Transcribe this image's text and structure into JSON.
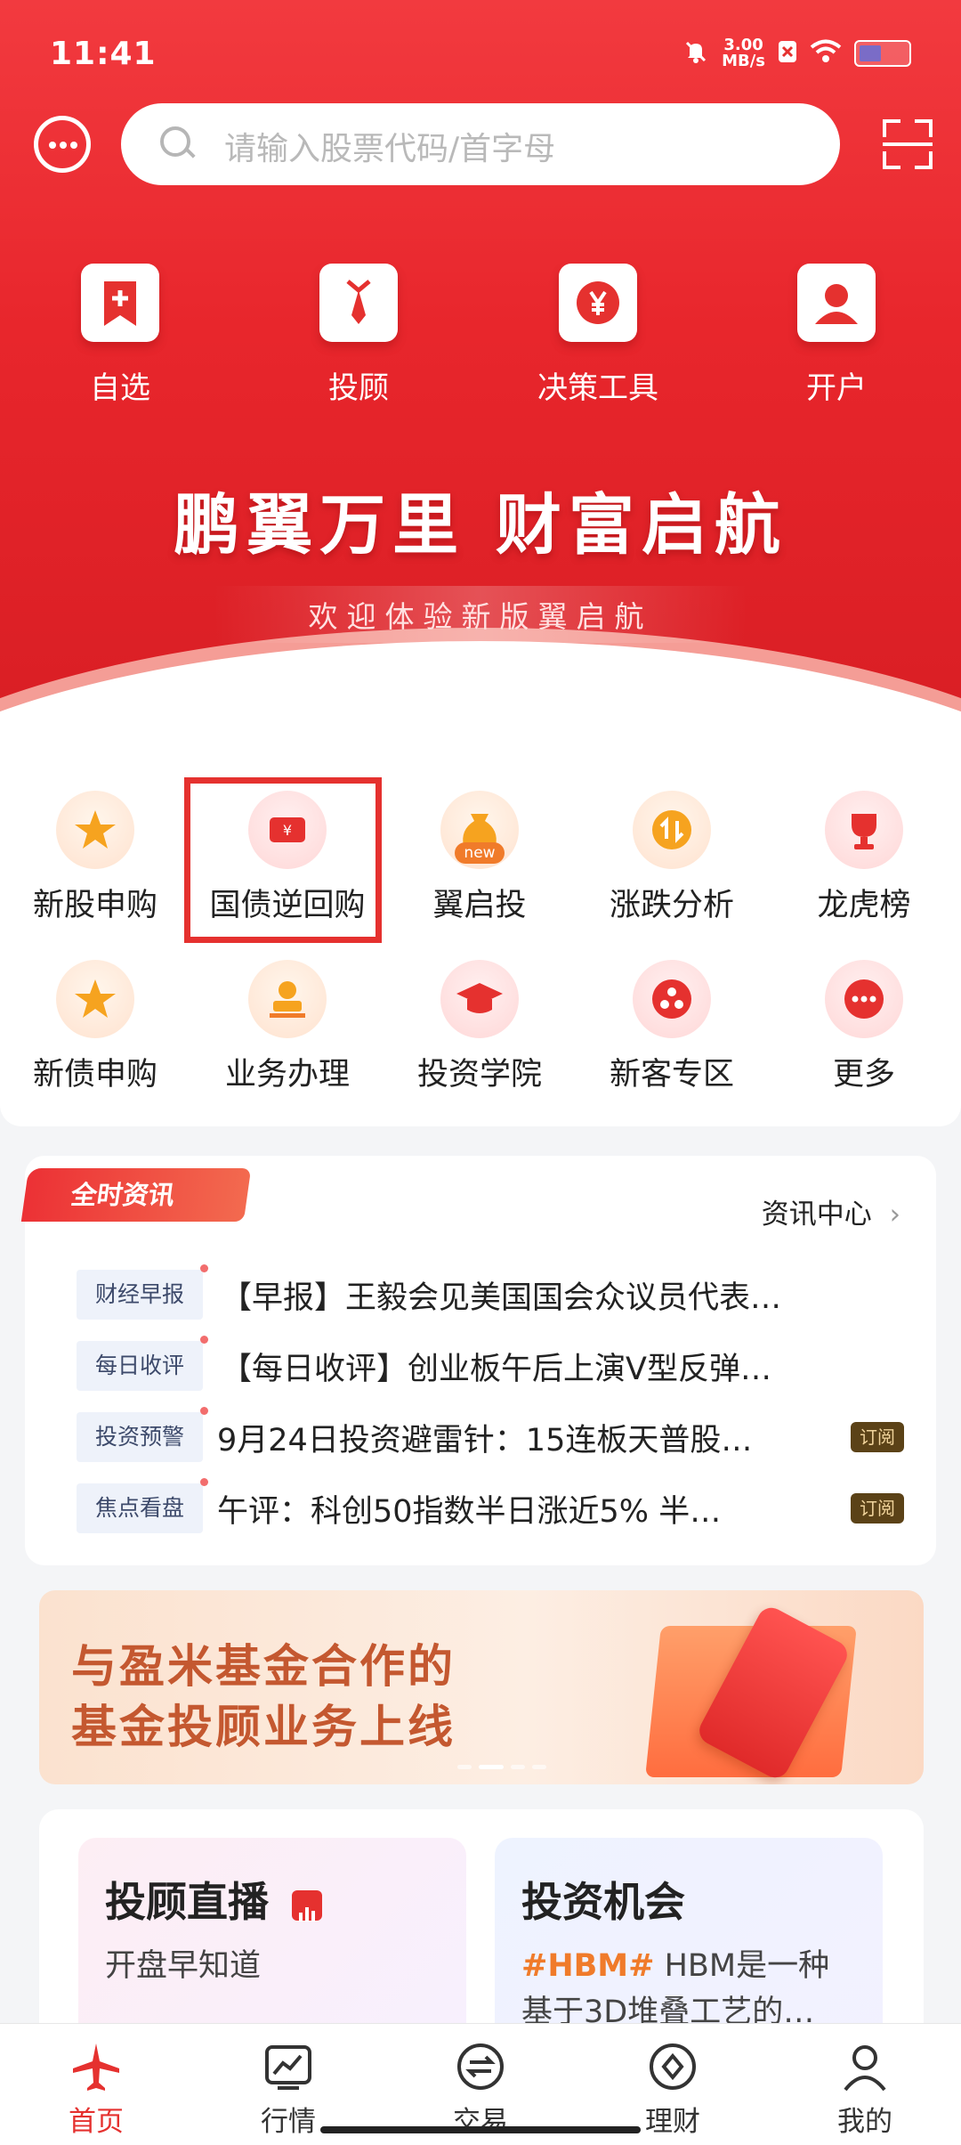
{
  "status": {
    "time": "11:41",
    "net_speed": "3.00",
    "net_unit": "MB/s"
  },
  "search": {
    "placeholder": "请输入股票代码/首字母"
  },
  "quick_actions": [
    {
      "label": "自选",
      "icon": "watchlist-icon"
    },
    {
      "label": "投顾",
      "icon": "advisor-icon"
    },
    {
      "label": "决策工具",
      "icon": "yen-icon"
    },
    {
      "label": "开户",
      "icon": "user-icon"
    }
  ],
  "hero": {
    "slogan": "鹏翼万里 财富启航",
    "subtitle": "欢迎体验新版翼启航"
  },
  "grid": [
    {
      "label": "新股申购",
      "icon": "star-icon"
    },
    {
      "label": "国债逆回购",
      "icon": "ticket-icon"
    },
    {
      "label": "翼启投",
      "icon": "money-bag-icon",
      "badge": "new"
    },
    {
      "label": "涨跌分析",
      "icon": "up-down-icon"
    },
    {
      "label": "龙虎榜",
      "icon": "trophy-icon"
    },
    {
      "label": "新债申购",
      "icon": "star-icon"
    },
    {
      "label": "业务办理",
      "icon": "stamp-icon"
    },
    {
      "label": "投资学院",
      "icon": "graduation-cap-icon"
    },
    {
      "label": "新客专区",
      "icon": "nodes-icon"
    },
    {
      "label": "更多",
      "icon": "more-icon"
    }
  ],
  "news": {
    "tag": "全时资讯",
    "center_link": "资讯中心",
    "items": [
      {
        "category": "财经早报",
        "title": "【早报】王毅会见美国国会众议员代表…",
        "subscribe": ""
      },
      {
        "category": "每日收评",
        "title": "【每日收评】创业板午后上演V型反弹…",
        "subscribe": ""
      },
      {
        "category": "投资预警",
        "title": "9月24日投资避雷针：15连板天普股…",
        "subscribe": "订阅"
      },
      {
        "category": "焦点看盘",
        "title": "午评：科创50指数半日涨近5% 半…",
        "subscribe": "订阅"
      }
    ]
  },
  "banner": {
    "line1": "与盈米基金合作的",
    "line2": "基金投顾业务上线"
  },
  "promo_cards": [
    {
      "title": "投顾直播",
      "desc": "开盘早知道"
    },
    {
      "title": "投资机会",
      "hashtag": "#HBM#",
      "desc": " HBM是一种",
      "desc2": "基于3D堆叠工艺的…"
    }
  ],
  "tabs": [
    {
      "label": "首页",
      "icon": "plane-icon",
      "active": true
    },
    {
      "label": "行情",
      "icon": "chart-icon"
    },
    {
      "label": "交易",
      "icon": "exchange-icon"
    },
    {
      "label": "理财",
      "icon": "diamond-icon"
    },
    {
      "label": "我的",
      "icon": "person-icon"
    }
  ],
  "colors": {
    "brand_red": "#e5312f",
    "subscribe_bg": "#5b4217",
    "hashtag": "#f07b2a"
  }
}
